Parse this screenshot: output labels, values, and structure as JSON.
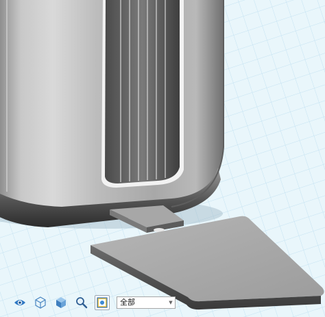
{
  "viewport": {
    "background_color": "#e9f6fb",
    "grid_color": "#bfdff0",
    "model_color": "#b4b4b4"
  },
  "toolbar": {
    "buttons": [
      {
        "name": "visibility-eye-icon",
        "icon": "eye"
      },
      {
        "name": "view-cube-icon",
        "icon": "wireframe-cube"
      },
      {
        "name": "shaded-cube-icon",
        "icon": "solid-cube"
      },
      {
        "name": "zoom-magnifier-icon",
        "icon": "magnifier"
      },
      {
        "name": "render-mode-icon",
        "icon": "picture"
      }
    ],
    "view_select": {
      "selected": "全部",
      "arrow": "▼"
    }
  }
}
